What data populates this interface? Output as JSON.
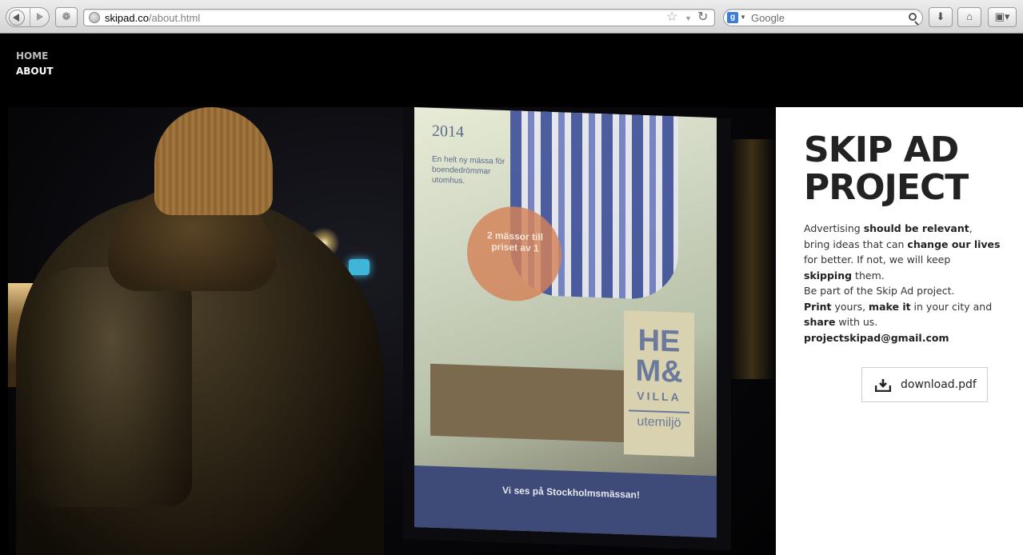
{
  "browser": {
    "url_host": "skipad.co",
    "url_path": "/about.html",
    "search_placeholder": "Google",
    "search_engine_letter": "g"
  },
  "nav": {
    "items": [
      {
        "label": "HOME"
      },
      {
        "label": "ABOUT"
      }
    ]
  },
  "hero": {
    "billboard_year": "2014",
    "billboard_copy": "En helt ny mässa för boendedrömmar utomhus.",
    "billboard_circle": "2 mässor till priset av 1",
    "billboard_logo_1": "HE",
    "billboard_logo_2": "M&",
    "billboard_logo_3": "VILLA",
    "billboard_logo_4": "utemiljö",
    "billboard_footer": "Vi ses på Stockholmsmässan!"
  },
  "about": {
    "title_line1": "SKIP AD",
    "title_line2": "PROJECT",
    "p1_a": "Advertising ",
    "p1_b": "should be relevant",
    "p1_c": ",",
    "p2_a": "bring ideas that can ",
    "p2_b": "change our lives",
    "p3": "for better. If not, we will keep",
    "p4_a": "skipping",
    "p4_b": " them.",
    "p5": "Be part of the Skip Ad project.",
    "p6_a": "Print",
    "p6_b": " yours, ",
    "p6_c": "make it",
    "p6_d": " in your city and",
    "p7_a": "share",
    "p7_b": " with us.",
    "email": "projectskipad@gmail.com",
    "download_label": "download.pdf"
  },
  "colors": {
    "page_bg": "#000000",
    "panel_bg": "#ffffff",
    "title": "#222222",
    "nav_inactive": "#bdbdbd",
    "nav_active": "#ffffff"
  }
}
